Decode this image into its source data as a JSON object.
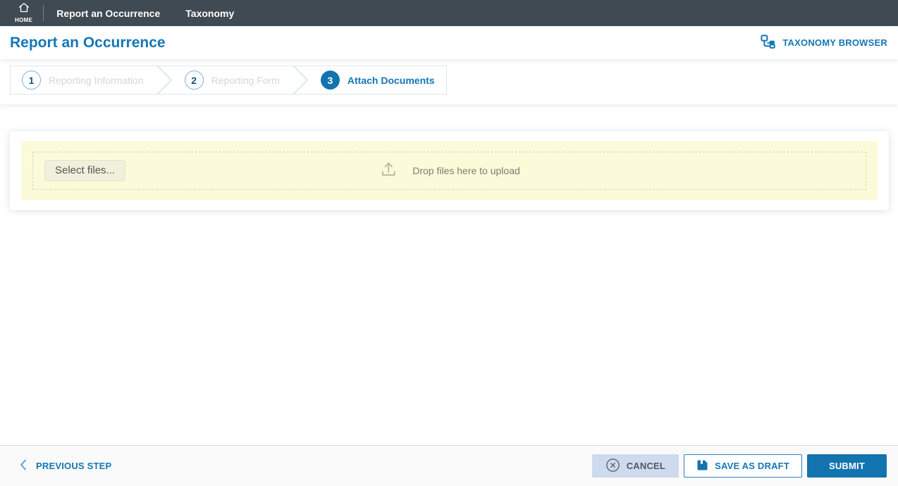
{
  "topbar": {
    "home_label": "HOME",
    "nav_items": [
      {
        "label": "Report an Occurrence"
      },
      {
        "label": "Taxonomy"
      }
    ]
  },
  "header": {
    "title": "Report an Occurrence",
    "taxonomy_browser_label": "TAXONOMY BROWSER"
  },
  "stepper": {
    "steps": [
      {
        "number": "1",
        "label": "Reporting Information",
        "state": "inactive"
      },
      {
        "number": "2",
        "label": "Reporting Form",
        "state": "inactive"
      },
      {
        "number": "3",
        "label": "Attach Documents",
        "state": "active"
      }
    ]
  },
  "upload": {
    "select_button_label": "Select files...",
    "drop_text": "Drop files here to upload"
  },
  "footer": {
    "previous_label": "PREVIOUS STEP",
    "cancel_label": "CANCEL",
    "save_draft_label": "SAVE AS DRAFT",
    "submit_label": "SUBMIT"
  },
  "icons": {
    "home": "home-icon",
    "taxonomy_browser": "tree-hierarchy-icon",
    "upload": "upload-tray-arrow-icon",
    "previous": "chevron-left-icon",
    "cancel": "circle-x-icon",
    "save_draft": "floppy-disk-icon"
  },
  "colors": {
    "topbar_bg": "#3f4a53",
    "accent_blue": "#1577b5",
    "active_step_bg": "#1273ae",
    "inactive_step_label": "#d3d7da",
    "upload_zone_bg": "#fbfbd9",
    "cancel_button_bg": "#cedaed",
    "submit_button_bg": "#1273ae",
    "footer_bg": "#fafafa"
  }
}
